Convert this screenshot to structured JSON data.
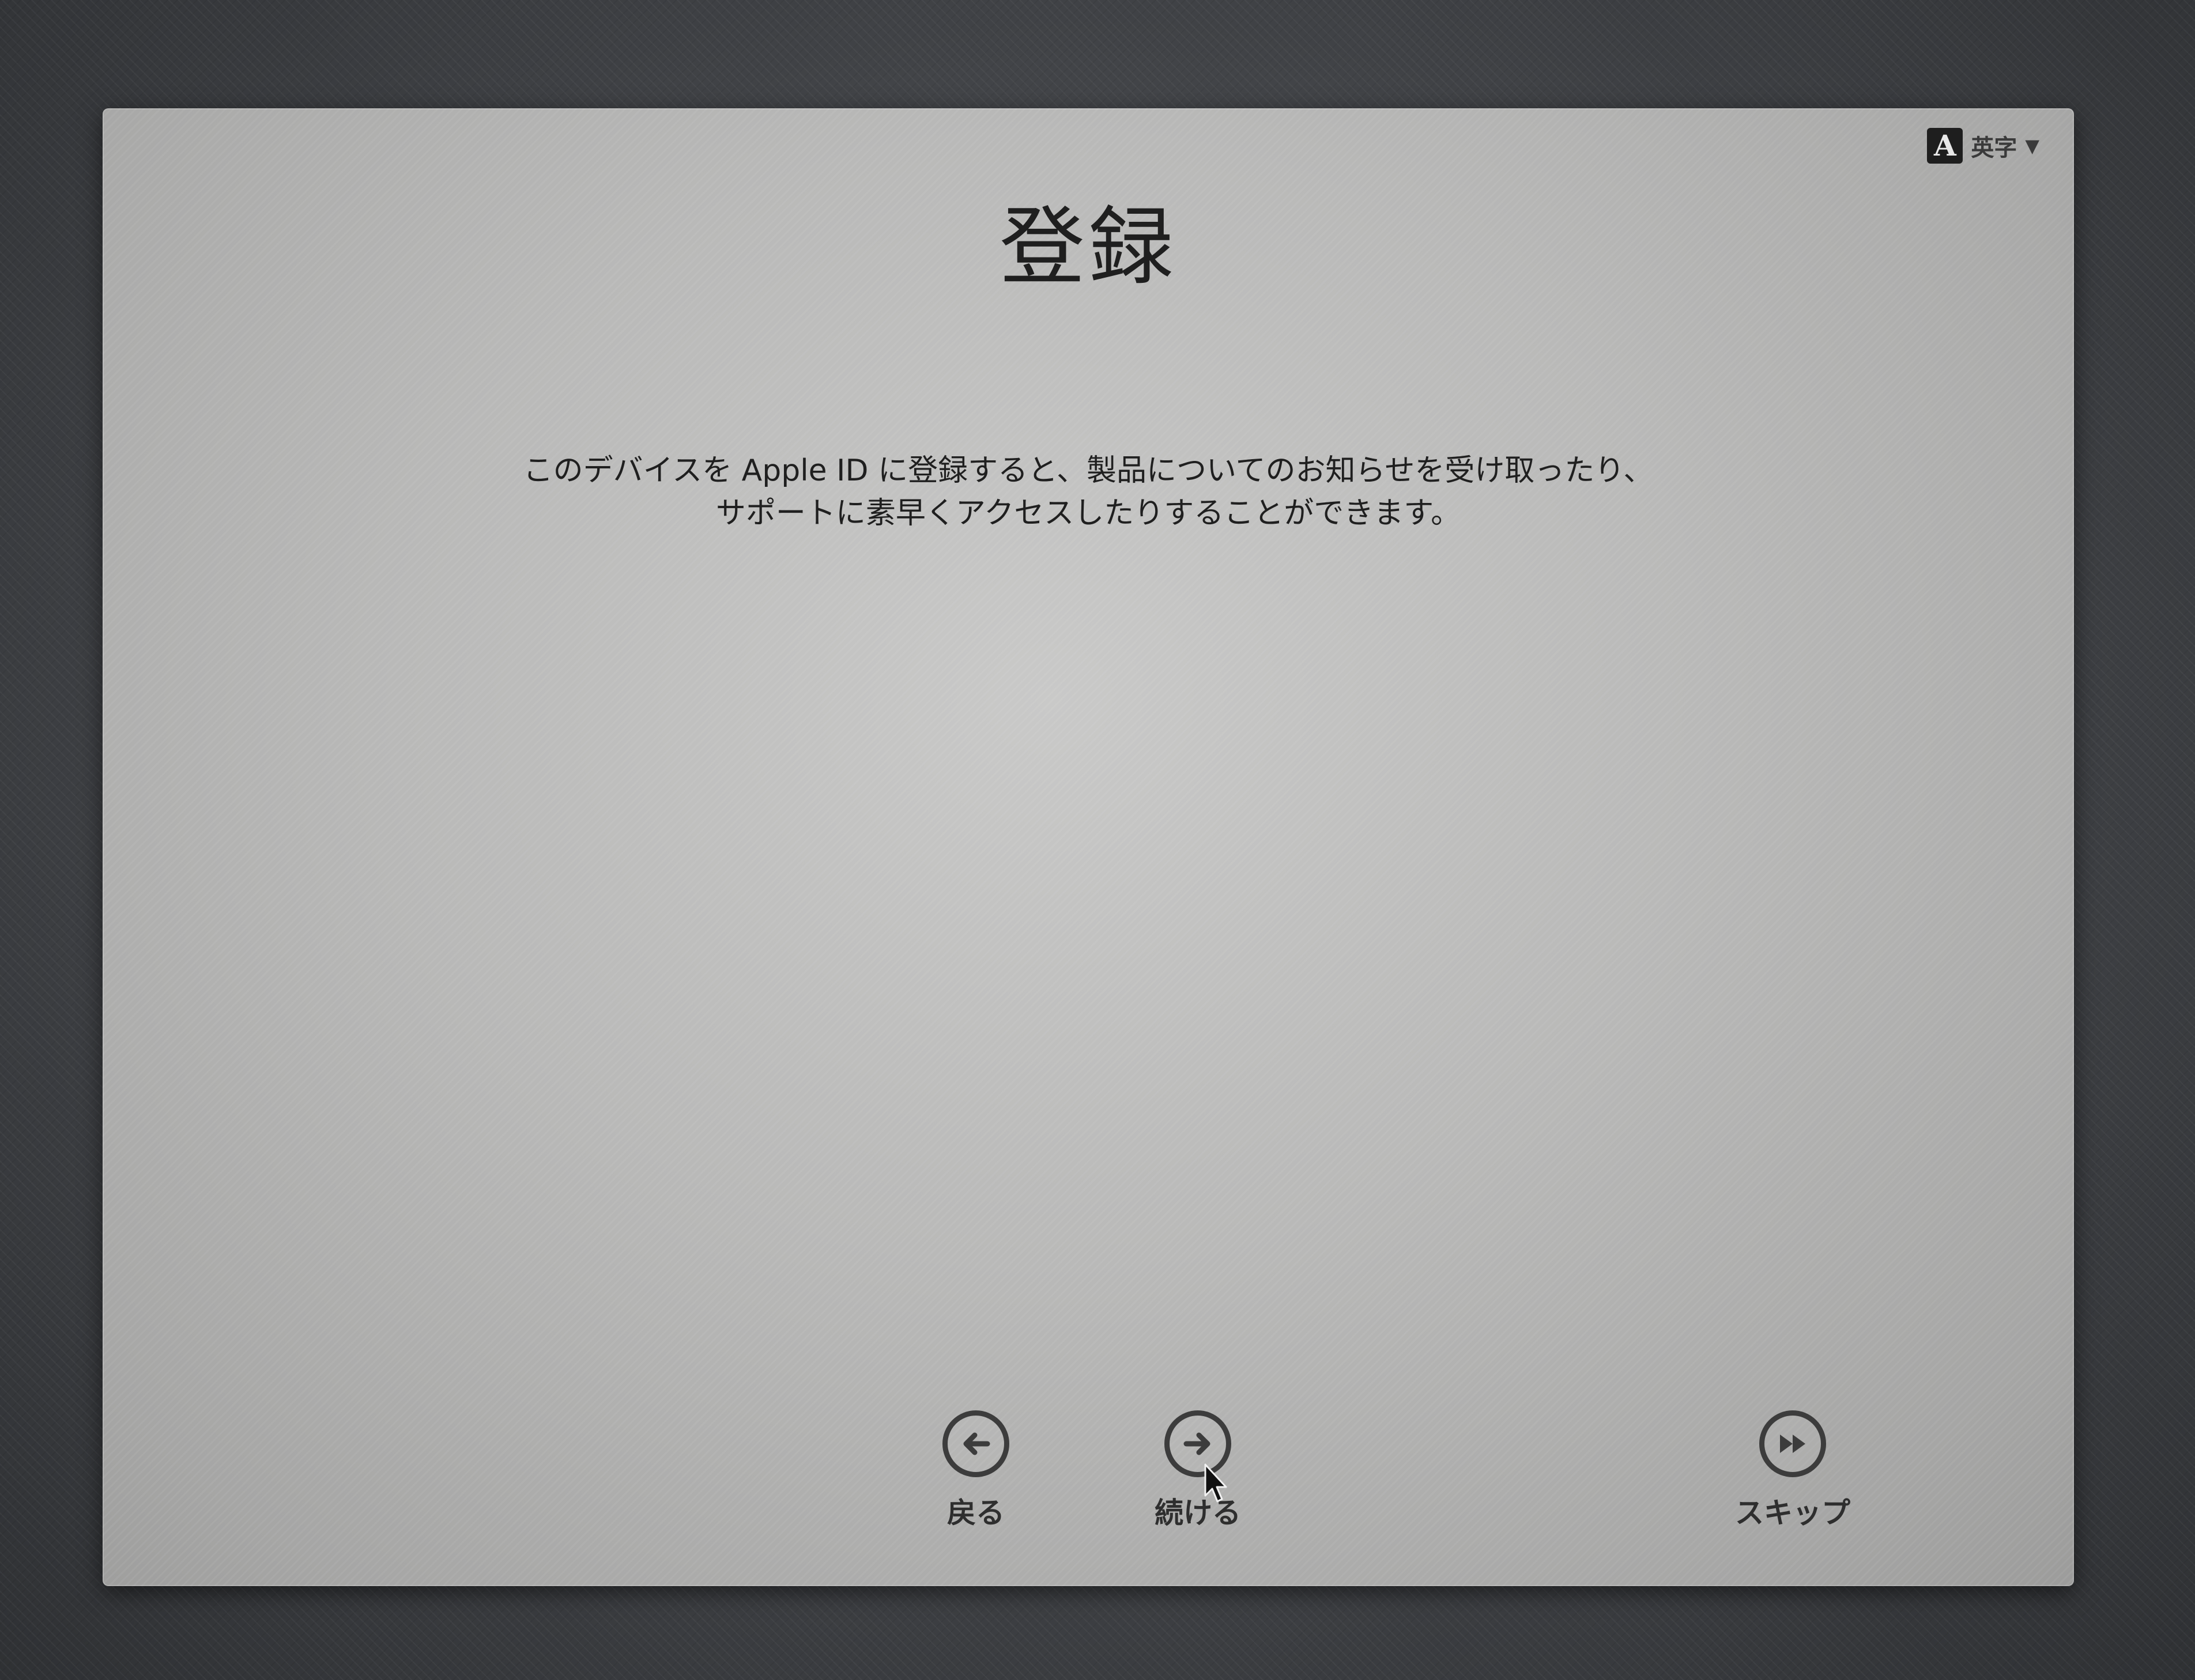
{
  "input_menu": {
    "icon_letter": "A",
    "label": "英字",
    "caret": "▼"
  },
  "page": {
    "title": "登録",
    "description_lines": [
      "このデバイスを Apple ID に登録すると、製品についてのお知らせを受け取ったり、",
      "サポートに素早くアクセスしたりすることができます。"
    ]
  },
  "nav": {
    "back": {
      "label": "戻る",
      "icon": "left-arrow-icon"
    },
    "continue": {
      "label": "続ける",
      "icon": "right-arrow-icon"
    },
    "skip": {
      "label": "スキップ",
      "icon": "fast-forward-icon"
    }
  },
  "colors": {
    "window_bg": "#b9b9b8",
    "text": "#1f1f1f",
    "desktop_bg": "#45474b"
  }
}
